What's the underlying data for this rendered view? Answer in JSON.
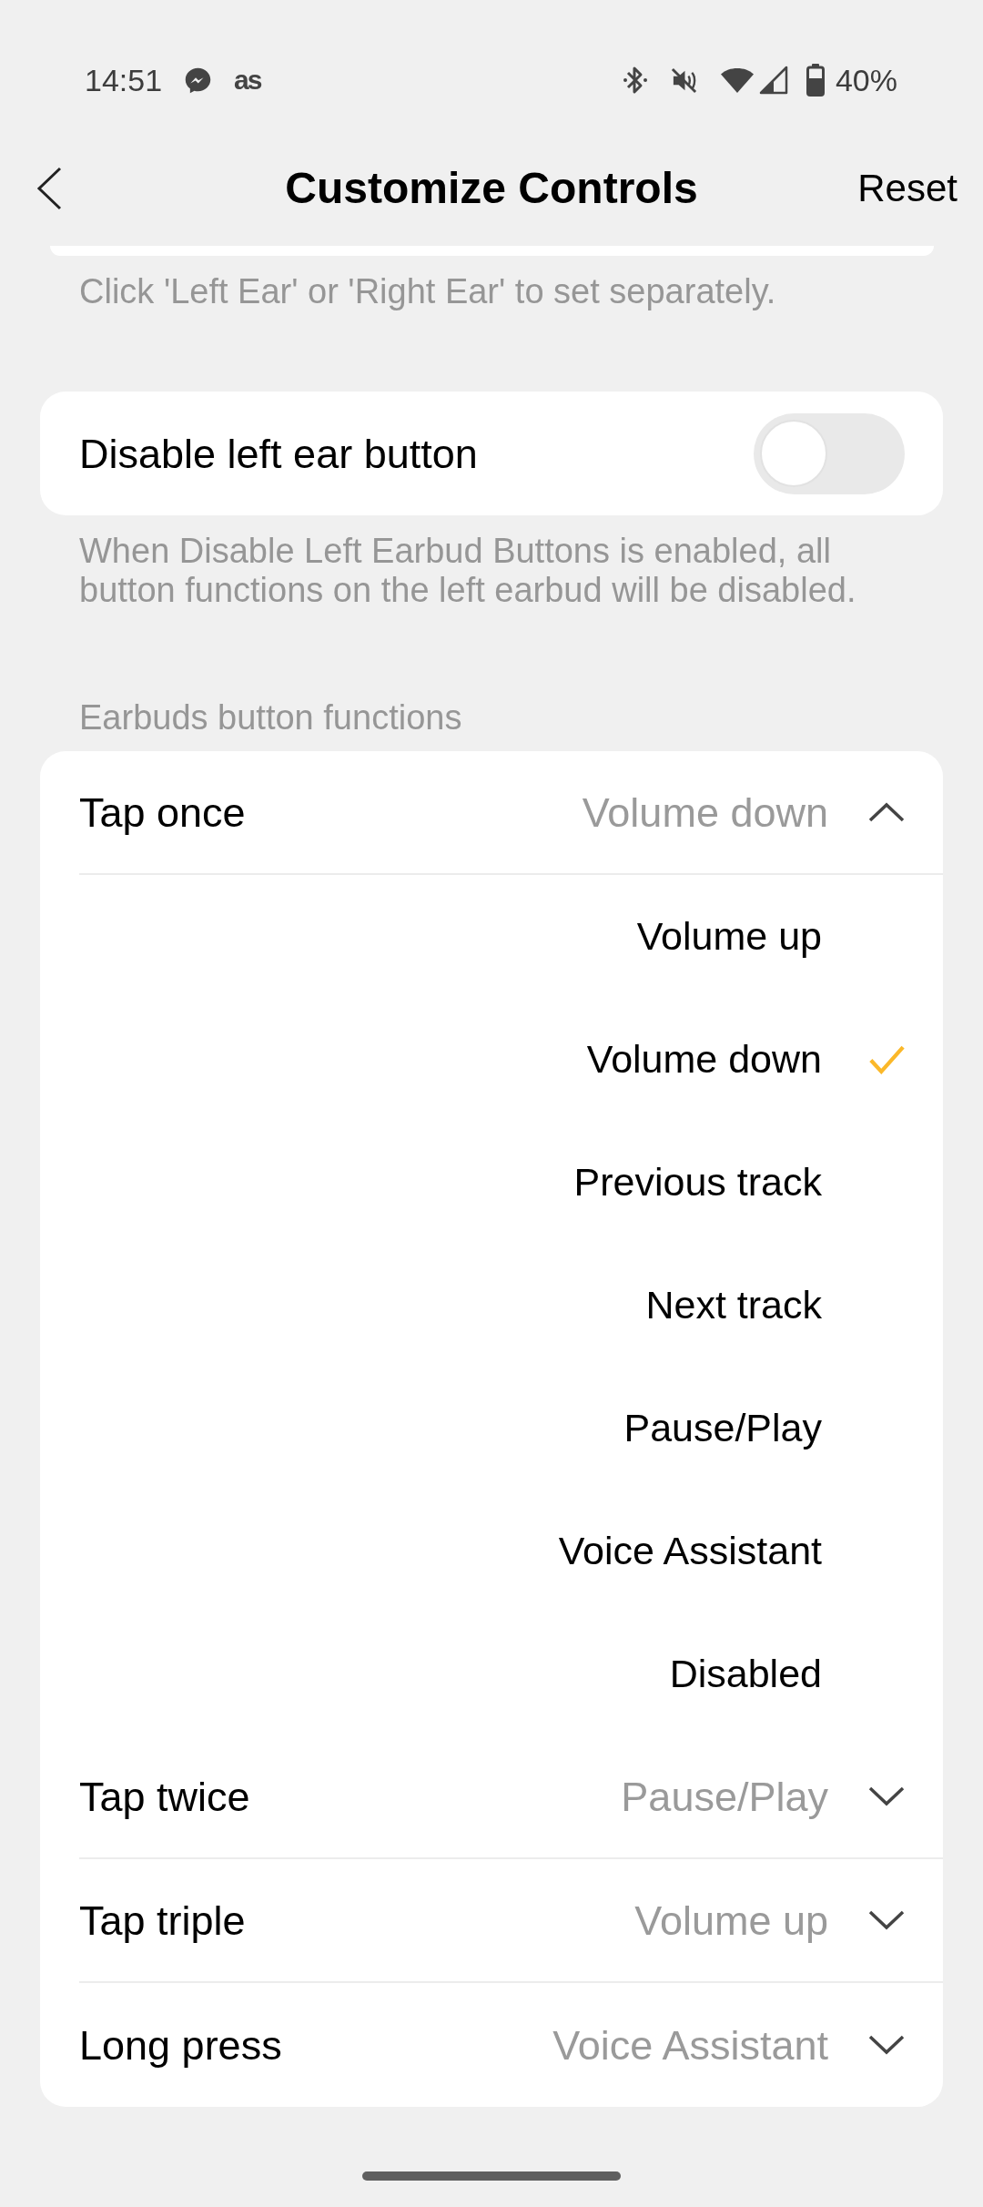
{
  "status_bar": {
    "time": "14:51",
    "notification_icon_text": "as",
    "battery_percent": "40%"
  },
  "header": {
    "title": "Customize Controls",
    "action": "Reset"
  },
  "ear_hint": "Click 'Left Ear' or 'Right Ear' to set separately.",
  "disable_left_ear": {
    "label": "Disable left ear button",
    "on": false
  },
  "disable_note": "When Disable Left Earbud Buttons is enabled, all button functions on the left earbud will be disabled.",
  "section_label": "Earbuds button functions",
  "functions": [
    {
      "label": "Tap once",
      "value": "Volume down",
      "expanded": true,
      "options": [
        {
          "label": "Volume up",
          "selected": false
        },
        {
          "label": "Volume down",
          "selected": true
        },
        {
          "label": "Previous track",
          "selected": false
        },
        {
          "label": "Next track",
          "selected": false
        },
        {
          "label": "Pause/Play",
          "selected": false
        },
        {
          "label": "Voice Assistant",
          "selected": false
        },
        {
          "label": "Disabled",
          "selected": false
        }
      ]
    },
    {
      "label": "Tap twice",
      "value": "Pause/Play",
      "expanded": false
    },
    {
      "label": "Tap triple",
      "value": "Volume up",
      "expanded": false
    },
    {
      "label": "Long press",
      "value": "Voice Assistant",
      "expanded": false
    }
  ]
}
